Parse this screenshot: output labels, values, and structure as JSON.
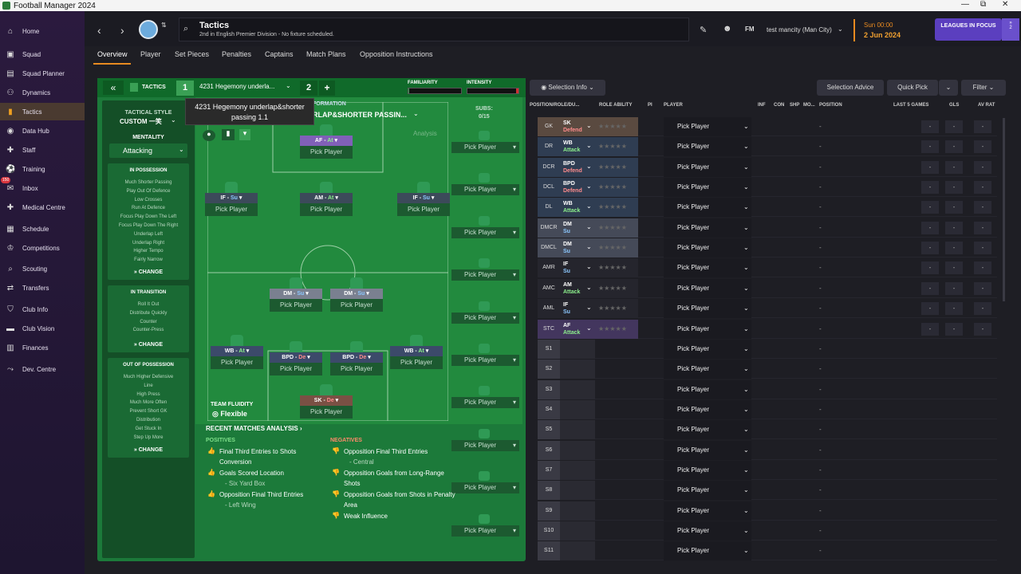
{
  "window": {
    "title": "Football Manager 2024",
    "controls": [
      "—",
      "⧉",
      "✕"
    ]
  },
  "sidebar": {
    "items": [
      {
        "label": "Home",
        "icon": "home-icon",
        "glyph": "⌂"
      },
      {
        "label": "Squad",
        "icon": "squad-icon",
        "glyph": "▣"
      },
      {
        "label": "Squad Planner",
        "icon": "squad-planner-icon",
        "glyph": "▤"
      },
      {
        "label": "Dynamics",
        "icon": "dynamics-icon",
        "glyph": "⚇"
      },
      {
        "label": "Tactics",
        "icon": "tactics-icon",
        "glyph": "▮"
      },
      {
        "label": "Data Hub",
        "icon": "data-hub-icon",
        "glyph": "◉"
      },
      {
        "label": "Staff",
        "icon": "staff-icon",
        "glyph": "✚"
      },
      {
        "label": "Training",
        "icon": "training-icon",
        "glyph": "⚽"
      },
      {
        "label": "Inbox",
        "icon": "inbox-icon",
        "glyph": "✉"
      },
      {
        "label": "Medical Centre",
        "icon": "medical-icon",
        "glyph": "✚"
      },
      {
        "label": "Schedule",
        "icon": "schedule-icon",
        "glyph": "▦"
      },
      {
        "label": "Competitions",
        "icon": "trophy-icon",
        "glyph": "♔"
      },
      {
        "label": "Scouting",
        "icon": "scouting-icon",
        "glyph": "⌕"
      },
      {
        "label": "Transfers",
        "icon": "transfers-icon",
        "glyph": "⇄"
      },
      {
        "label": "Club Info",
        "icon": "club-info-icon",
        "glyph": "⛉"
      },
      {
        "label": "Club Vision",
        "icon": "club-vision-icon",
        "glyph": "▬"
      },
      {
        "label": "Finances",
        "icon": "finances-icon",
        "glyph": "▥"
      },
      {
        "label": "Dev. Centre",
        "icon": "dev-centre-icon",
        "glyph": "⤳"
      }
    ],
    "inbox_badge": "150"
  },
  "header": {
    "title": "Tactics",
    "subtitle": "2nd in English Premier Division - No fixture scheduled.",
    "fm_label": "FM",
    "club": "test mancity (Man City)",
    "time": "Sun 00:00",
    "date": "2 Jun 2024",
    "leagues_btn": "LEAGUES IN FOCUS",
    "leagues_count": "2"
  },
  "tabs": [
    "Overview",
    "Player",
    "Set Pieces",
    "Penalties",
    "Captains",
    "Match Plans",
    "Opposition Instructions"
  ],
  "tactics": {
    "label": "TACTICS",
    "slot1": "1",
    "name": "4231 Hegemony underla...",
    "slot2": "2",
    "add": "+",
    "familiarity_label": "FAMILIARITY",
    "intensity_label": "INTENSITY",
    "familiarity": 0.02,
    "intensity": 0.05,
    "tooltip": "4231 Hegemony underlap&shorter passing 1.1",
    "formation_label": "FORMATION",
    "formation_name": "RLAP&SHORTER PASSIN...",
    "subs_label": "SUBS:",
    "subs_count": "0/15",
    "analysis_label": "Analysis",
    "style_label": "TACTICAL STYLE",
    "style_value": "CUSTOM 一笑",
    "mentality_label": "MENTALITY",
    "mentality_value": "Attacking",
    "in_possession": {
      "title": "IN POSSESSION",
      "items": [
        "Much Shorter Passing",
        "Play Out Of Defence",
        "Low Crosses",
        "Run At Defence",
        "Focus Play Down The Left",
        "Focus Play Down The Right",
        "Underlap Left",
        "Underlap Right",
        "Higher Tempo",
        "Fairly Narrow"
      ]
    },
    "in_transition": {
      "title": "IN TRANSITION",
      "items": [
        "Roll It Out",
        "Distribute Quickly",
        "Counter",
        "Counter-Press"
      ]
    },
    "out_of_possession": {
      "title": "OUT OF POSSESSION",
      "items": [
        "Much Higher Defensive",
        "Line",
        "High Press",
        "Much More Often",
        "Prevent Short GK",
        "Distribution",
        "Get Stuck In",
        "Step Up More"
      ]
    },
    "change_label": "CHANGE",
    "team_fluidity_label": "TEAM FLUIDITY",
    "team_fluidity_value": "Flexible",
    "pick_label": "Pick Player"
  },
  "players": [
    {
      "pos": "AF",
      "duty": "At",
      "cls": "att"
    },
    {
      "pos": "IF",
      "duty": "Su",
      "cls": "mid"
    },
    {
      "pos": "AM",
      "duty": "At",
      "cls": "mid"
    },
    {
      "pos": "IF",
      "duty": "Su",
      "cls": "mid"
    },
    {
      "pos": "DM",
      "duty": "Su",
      "cls": "dm"
    },
    {
      "pos": "DM",
      "duty": "Su",
      "cls": "dm"
    },
    {
      "pos": "WB",
      "duty": "At",
      "cls": "def"
    },
    {
      "pos": "BPD",
      "duty": "De",
      "cls": "def"
    },
    {
      "pos": "BPD",
      "duty": "De",
      "cls": "def"
    },
    {
      "pos": "WB",
      "duty": "At",
      "cls": "def"
    },
    {
      "pos": "SK",
      "duty": "De",
      "cls": "gk"
    }
  ],
  "analysis": {
    "title": "RECENT MATCHES ANALYSIS",
    "positives_label": "POSITIVES",
    "negatives_label": "NEGATIVES",
    "positives": [
      {
        "text": "Final Third Entries to Shots Conversion",
        "sub": ""
      },
      {
        "text": "Goals Scored Location",
        "sub": "- Six Yard Box"
      },
      {
        "text": "Opposition Final Third Entries",
        "sub": "- Left Wing"
      }
    ],
    "negatives": [
      {
        "text": "Opposition Final Third Entries",
        "sub": "- Central"
      },
      {
        "text": "Opposition Goals from Long-Range Shots",
        "sub": ""
      },
      {
        "text": "Opposition Goals from Shots in Penalty Area",
        "sub": ""
      },
      {
        "text": "Weak Influence",
        "sub": ""
      }
    ]
  },
  "right": {
    "selection_info": "Selection Info",
    "selection_advice": "Selection Advice",
    "quick_pick": "Quick Pick",
    "filter": "Filter",
    "columns": [
      "POSITION/ROLE/DU...",
      "ROLE ABILITY",
      "PI",
      "PLAYER",
      "INF",
      "CON",
      "SHP",
      "MO...",
      "POSITION",
      "LAST 5 GAMES",
      "GLS",
      "AV RAT"
    ],
    "rows": [
      {
        "pos": "GK",
        "role": "SK",
        "duty": "Defend",
        "dc": "d",
        "bg": "#5a4a40"
      },
      {
        "pos": "DR",
        "role": "WB",
        "duty": "Attack",
        "dc": "a",
        "bg": "#2f3d52"
      },
      {
        "pos": "DCR",
        "role": "BPD",
        "duty": "Defend",
        "dc": "d",
        "bg": "#2f3d52"
      },
      {
        "pos": "DCL",
        "role": "BPD",
        "duty": "Defend",
        "dc": "d",
        "bg": "#2f3d52"
      },
      {
        "pos": "DL",
        "role": "WB",
        "duty": "Attack",
        "dc": "a",
        "bg": "#2f3d52"
      },
      {
        "pos": "DMCR",
        "role": "DM",
        "duty": "Su",
        "dc": "s",
        "bg": "#454a58"
      },
      {
        "pos": "DMCL",
        "role": "DM",
        "duty": "Su",
        "dc": "s",
        "bg": "#454a58"
      },
      {
        "pos": "AMR",
        "role": "IF",
        "duty": "Su",
        "dc": "s",
        "bg": "#25252d"
      },
      {
        "pos": "AMC",
        "role": "AM",
        "duty": "Attack",
        "dc": "a",
        "bg": "#25252d"
      },
      {
        "pos": "AML",
        "role": "IF",
        "duty": "Su",
        "dc": "s",
        "bg": "#25252d"
      },
      {
        "pos": "STC",
        "role": "AF",
        "duty": "Attack",
        "dc": "a",
        "bg": "#43365e"
      },
      {
        "pos": "S1"
      },
      {
        "pos": "S2"
      },
      {
        "pos": "S3"
      },
      {
        "pos": "S4"
      },
      {
        "pos": "S5"
      },
      {
        "pos": "S6"
      },
      {
        "pos": "S7"
      },
      {
        "pos": "S8"
      },
      {
        "pos": "S9"
      },
      {
        "pos": "S10"
      },
      {
        "pos": "S11"
      }
    ],
    "dash": "-",
    "stars": "★★★★★"
  }
}
